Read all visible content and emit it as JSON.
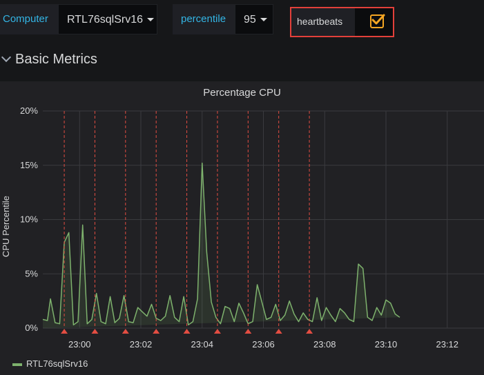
{
  "variables": {
    "computer": {
      "label": "Computer",
      "value": "RTL76sqlSrv16"
    },
    "percentile": {
      "label": "percentile",
      "value": "95"
    },
    "heartbeats": {
      "label": "heartbeats",
      "checked": true
    }
  },
  "row": {
    "title": "Basic Metrics"
  },
  "panel": {
    "title": "Percentage CPU"
  },
  "chart_data": {
    "type": "line",
    "title": "Percentage CPU",
    "ylabel": "CPU Percentile",
    "xlabel": "",
    "ylim": [
      0,
      20
    ],
    "y_ticks": [
      "0%",
      "5%",
      "10%",
      "15%",
      "20%"
    ],
    "x_ticks": [
      "23:00",
      "23:02",
      "23:04",
      "23:06",
      "23:08",
      "23:10",
      "23:12"
    ],
    "x_tick_minutes": [
      0,
      2,
      4,
      6,
      8,
      10,
      12
    ],
    "xlim_minutes": [
      -1.2,
      13.2
    ],
    "series": [
      {
        "name": "RTL76sqlSrv16",
        "color": "#7eb26d",
        "x_minutes": [
          -1.2,
          -1.05,
          -0.95,
          -0.8,
          -0.65,
          -0.5,
          -0.35,
          -0.2,
          -0.05,
          0.1,
          0.25,
          0.4,
          0.55,
          0.7,
          0.85,
          1.0,
          1.15,
          1.3,
          1.45,
          1.6,
          1.75,
          1.9,
          2.05,
          2.2,
          2.35,
          2.5,
          2.65,
          2.8,
          2.95,
          3.1,
          3.25,
          3.4,
          3.55,
          3.7,
          3.85,
          4.0,
          4.15,
          4.3,
          4.45,
          4.6,
          4.75,
          4.9,
          5.05,
          5.2,
          5.35,
          5.5,
          5.65,
          5.8,
          5.95,
          6.1,
          6.25,
          6.4,
          6.55,
          6.7,
          6.85,
          7.0,
          7.15,
          7.3,
          7.45,
          7.6,
          7.75,
          7.9,
          8.05,
          8.2,
          8.35,
          8.5,
          8.65,
          8.8,
          8.95,
          9.1,
          9.25,
          9.4,
          9.55,
          9.7,
          9.85,
          10.0,
          10.15,
          10.3,
          10.45,
          10.6,
          10.75,
          10.9,
          11.05
        ],
        "values": [
          0.8,
          0.7,
          2.7,
          0.5,
          0.4,
          7.9,
          8.8,
          0.3,
          0.6,
          9.5,
          0.4,
          0.8,
          3.2,
          0.6,
          0.4,
          2.9,
          0.5,
          0.9,
          3.0,
          0.6,
          0.5,
          1.9,
          1.5,
          1.1,
          2.2,
          0.9,
          0.7,
          1.1,
          3.0,
          1.0,
          0.6,
          2.9,
          0.3,
          0.6,
          2.7,
          15.2,
          7.0,
          2.4,
          1.0,
          0.4,
          2.0,
          1.8,
          0.6,
          2.3,
          1.4,
          0.4,
          0.6,
          4.0,
          2.4,
          0.8,
          1.0,
          2.2,
          0.7,
          1.2,
          2.5,
          1.3,
          0.6,
          1.4,
          0.8,
          0.6,
          2.8,
          0.7,
          1.9,
          1.2,
          0.6,
          1.8,
          1.4,
          0.8,
          0.6,
          5.9,
          5.5,
          1.0,
          0.7,
          1.9,
          1.2,
          2.6,
          2.3,
          1.3,
          1.0
        ]
      }
    ],
    "heartbeats_minutes": [
      -0.5,
      0.5,
      1.5,
      2.5,
      3.5,
      4.5,
      5.5,
      6.5,
      7.5
    ],
    "heartbeat_color": "#e24d42",
    "grid": true,
    "legend": "bottom-left"
  }
}
